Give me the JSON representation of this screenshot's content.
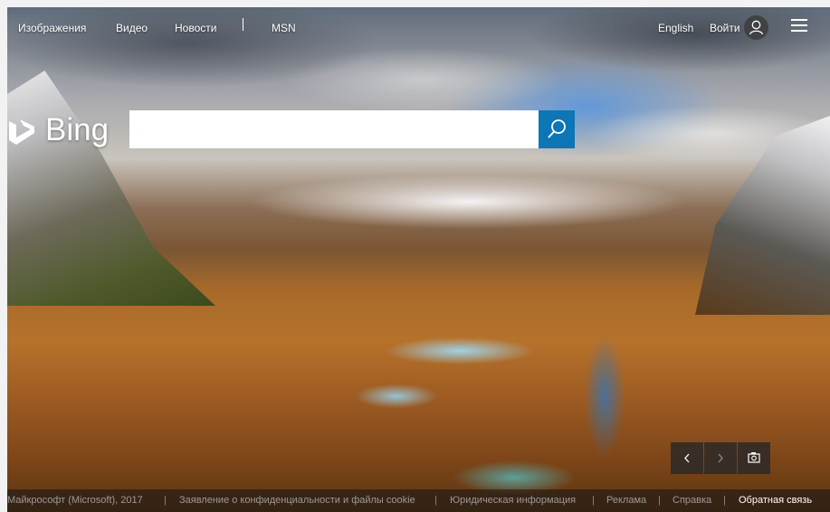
{
  "topnav": {
    "links": [
      {
        "label": "Изображения"
      },
      {
        "label": "Видео"
      },
      {
        "label": "Новости"
      },
      {
        "label": "MSN"
      }
    ],
    "language": "English",
    "signin": "Войти"
  },
  "logo": {
    "text": "Bing"
  },
  "search": {
    "value": "",
    "placeholder": ""
  },
  "footer": {
    "items": [
      "Майкрософт (Microsoft), 2017",
      "Заявление о конфиденциальности и файлы cookie",
      "Юридическая информация",
      "Реклама",
      "Справка",
      "Обратная связь"
    ],
    "separator": "|"
  },
  "colors": {
    "search_button": "#0c76b6",
    "nav_text": "#ffffff",
    "footer_text": "#9a9a9a"
  },
  "icons": {
    "search": "magnifier-icon",
    "user": "user-icon",
    "menu": "hamburger-icon",
    "prev": "chevron-left-icon",
    "next": "chevron-right-icon",
    "camera": "camera-icon"
  }
}
